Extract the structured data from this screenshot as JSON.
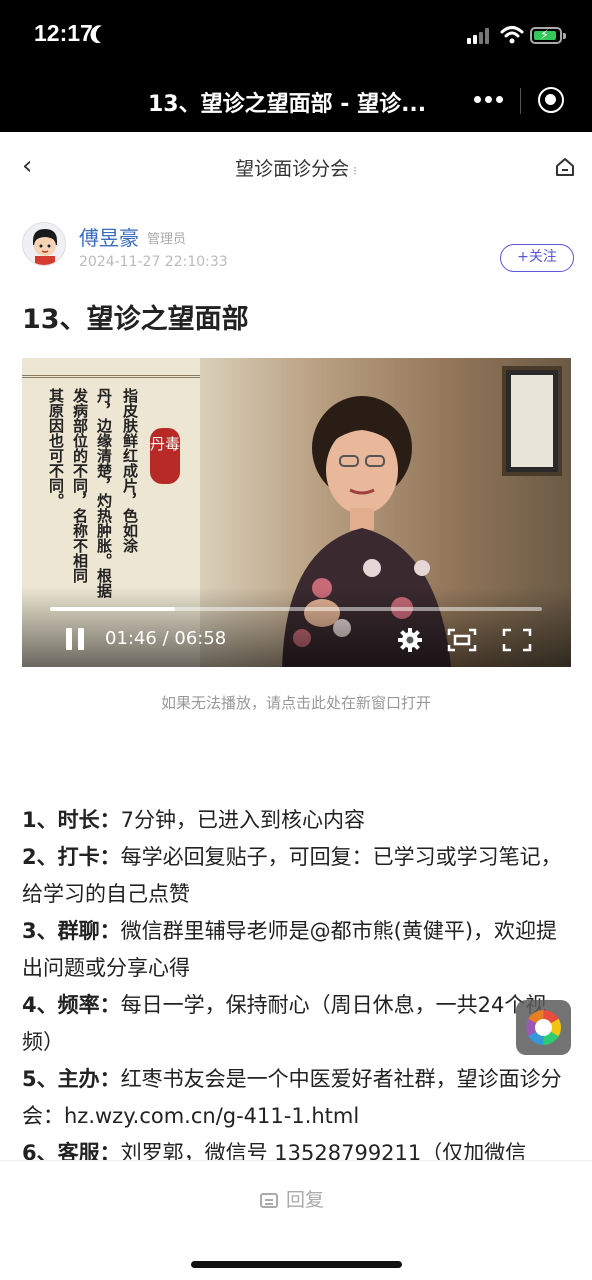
{
  "status_bar": {
    "time": "12:17"
  },
  "wechat_bar": {
    "title": "13、望诊之望面部 - 望诊..."
  },
  "nav": {
    "title": "望诊面诊分会",
    "title_suffix": "⁝"
  },
  "author": {
    "name": "傅昱豪",
    "role": "管理员",
    "time": "2024-11-27 22:10:33",
    "follow_label": "+关注"
  },
  "post": {
    "title": "13、望诊之望面部"
  },
  "video": {
    "current": "01:46",
    "duration": "06:58",
    "time_display": "01:46 / 06:58",
    "progress": 0.254,
    "seal_text": "丹毒",
    "caption_columns": [
      "指皮肤鲜红成片，色如涂",
      "丹，边缘清楚，灼热肿胀。根据",
      "发病部位的不同，名称不相同",
      "其原因也可不同。"
    ]
  },
  "video_hint": "如果无法播放，请点击此处在新窗口打开",
  "content": {
    "items": [
      {
        "label": "1、时长：",
        "text": "7分钟，已进入到核心内容"
      },
      {
        "label": "2、打卡：",
        "text": "每学必回复贴子，可回复：已学习或学习笔记，给学习的自己点赞"
      },
      {
        "label": "3、群聊：",
        "text": "微信群里辅导老师是@都市熊(黄健平)，欢迎提出问题或分享心得"
      },
      {
        "label": "4、频率：",
        "text": "每日一学，保持耐心（周日休息，一共24个视频）"
      },
      {
        "label": "5、主办：",
        "text": "红枣书友会是一个中医爱好者社群，望诊面诊分会：hz.wzy.com.cn/g-411-1.html"
      },
      {
        "label": "6、客服：",
        "text": "刘罗郭，微信号 13528799211（仅加微信"
      }
    ]
  },
  "bottom_bar": {
    "reply_label": "回复"
  },
  "colors": {
    "accent": "#5a56d6",
    "author_name": "#3a6cc0",
    "battery": "#34c759"
  },
  "icons": [
    "moon-icon",
    "signal-icon",
    "wifi-icon",
    "battery-icon",
    "more-icon",
    "close-circle-icon",
    "back-icon",
    "home-icon",
    "pause-icon",
    "gear-icon",
    "pip-icon",
    "fullscreen-icon",
    "aperture-icon",
    "chat-icon"
  ]
}
